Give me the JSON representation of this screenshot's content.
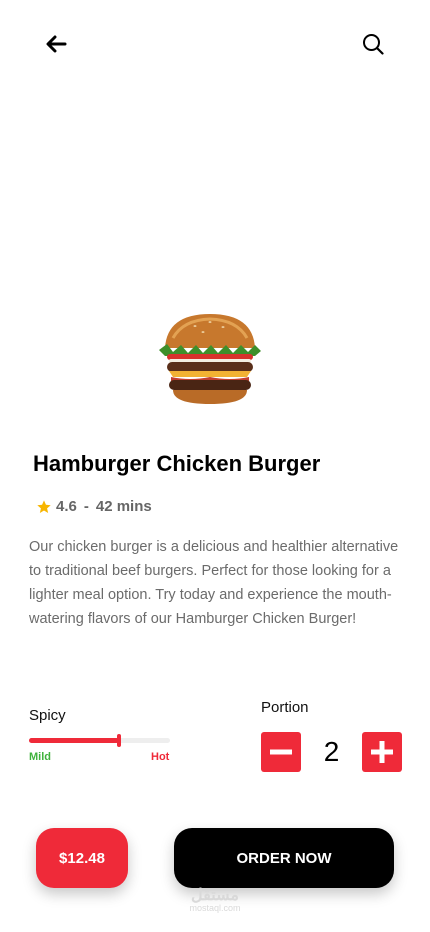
{
  "header": {
    "back_icon": "arrow-left-icon",
    "search_icon": "search-icon"
  },
  "product": {
    "title": "Hamburger Chicken Burger",
    "rating": "4.6",
    "separator": "-",
    "time": "42 mins",
    "description": "Our chicken burger is a delicious and healthier alternative to traditional beef burgers. Perfect for those looking for a lighter meal option. Try today and experience the mouth-watering flavors of our Hamburger Chicken Burger!"
  },
  "spicy": {
    "label": "Spicy",
    "min_label": "Mild",
    "max_label": "Hot",
    "level": 0.64
  },
  "portion": {
    "label": "Portion",
    "value": "2"
  },
  "footer": {
    "price": "$12.48",
    "order_label": "ORDER NOW"
  },
  "watermark": {
    "arabic": "مستقل",
    "latin": "mostaql.com"
  },
  "colors": {
    "accent": "#ef2a39",
    "mild": "#3fb23c",
    "primary_button": "#000000"
  }
}
